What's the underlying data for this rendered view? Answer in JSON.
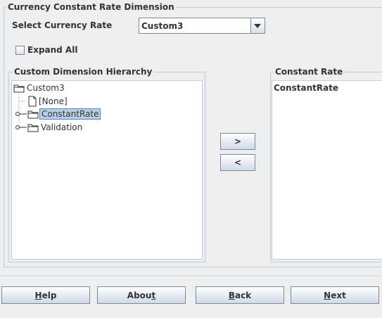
{
  "group": {
    "title": "Currency Constant Rate Dimension"
  },
  "currency_rate": {
    "label": "Select Currency Rate",
    "selected": "Custom3"
  },
  "expand_all": {
    "label": "Expand All",
    "checked": false
  },
  "hierarchy": {
    "title": "Custom Dimension Hierarchy",
    "root": "Custom3",
    "items": [
      "[None]",
      "ConstantRate",
      "Validation"
    ],
    "selected": "ConstantRate"
  },
  "move": {
    "add_label": ">",
    "remove_label": "<"
  },
  "constant_rate": {
    "title": "Constant Rate",
    "items": [
      "ConstantRate"
    ]
  },
  "footer": {
    "help": {
      "mnemonic": "H",
      "rest": "elp"
    },
    "about": {
      "before": "Abou",
      "mnemonic": "t"
    },
    "back": {
      "mnemonic": "B",
      "rest": "ack"
    },
    "next": {
      "mnemonic": "N",
      "rest": "ext"
    }
  }
}
